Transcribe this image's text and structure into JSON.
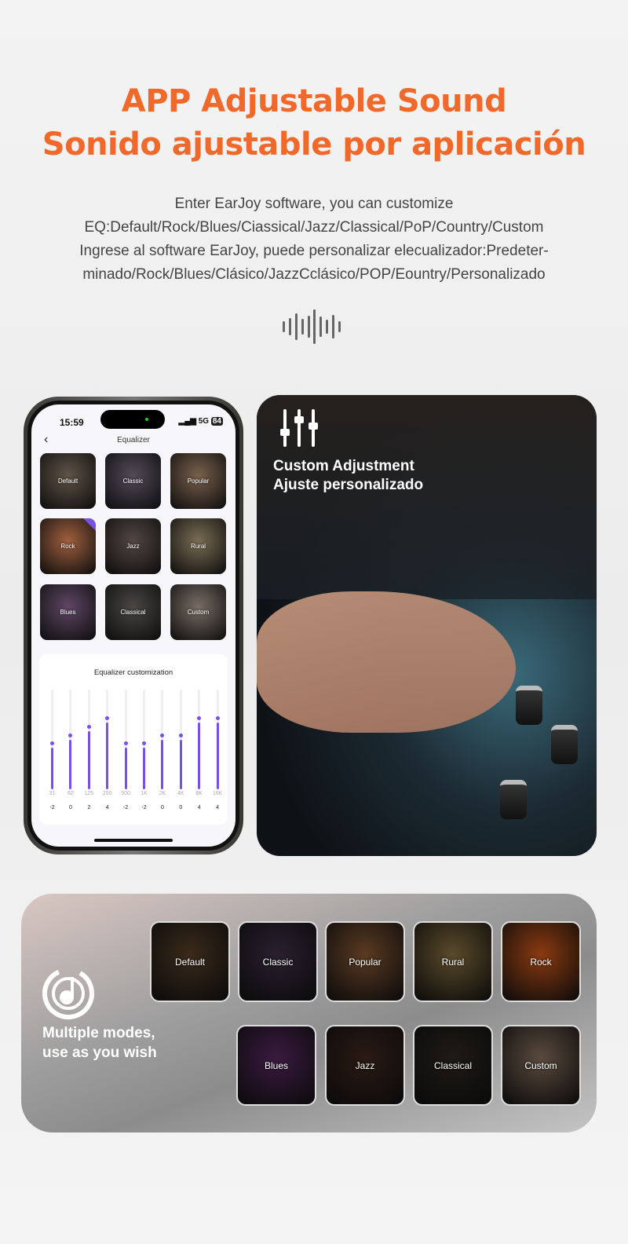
{
  "header": {
    "title_en": "APP Adjustable Sound",
    "title_es": "Sonido ajustable por aplicación",
    "accent": "#f0692a"
  },
  "description": [
    "Enter EarJoy software, you can customize",
    "EQ:Default/Rock/Blues/Ciassical/Jazz/Classical/PoP/Country/Custom",
    "Ingrese al software EarJoy, puede personalizar elecualizador:Predeter-",
    "minado/Rock/Blues/Clásico/JazzCclásico/POP/Eountry/Personalizado"
  ],
  "decor_icon": "sound-wave-icon",
  "phone": {
    "status": {
      "time": "15:59",
      "network": "5G",
      "battery": "84"
    },
    "nav": {
      "title": "Equalizer",
      "back_icon": "chevron-left-icon"
    },
    "presets": [
      {
        "label": "Default",
        "selected": false,
        "color": "#3a2a1a"
      },
      {
        "label": "Classic",
        "selected": false,
        "color": "#2a2030"
      },
      {
        "label": "Popular",
        "selected": false,
        "color": "#5a3a22"
      },
      {
        "label": "Rock",
        "selected": true,
        "color": "#8a3a10"
      },
      {
        "label": "Jazz",
        "selected": false,
        "color": "#2a1a14"
      },
      {
        "label": "Rural",
        "selected": false,
        "color": "#5a4a2a"
      },
      {
        "label": "Blues",
        "selected": false,
        "color": "#3a1a40"
      },
      {
        "label": "Classical",
        "selected": false,
        "color": "#1e1a16"
      },
      {
        "label": "Custom",
        "selected": false,
        "color": "#5a4a3e"
      }
    ],
    "eq": {
      "title": "Equalizer customization",
      "range_db": [
        -12,
        12
      ],
      "bands": [
        {
          "freq": "31",
          "gain": "-2"
        },
        {
          "freq": "62",
          "gain": "0"
        },
        {
          "freq": "125",
          "gain": "2"
        },
        {
          "freq": "250",
          "gain": "4"
        },
        {
          "freq": "500",
          "gain": "-2"
        },
        {
          "freq": "1K",
          "gain": "-2"
        },
        {
          "freq": "2K",
          "gain": "0"
        },
        {
          "freq": "4K",
          "gain": "0"
        },
        {
          "freq": "8K",
          "gain": "4"
        },
        {
          "freq": "16K",
          "gain": "4"
        }
      ],
      "accent": "#7a4fe6"
    }
  },
  "custom_panel": {
    "icon": "sliders-icon",
    "title_en": "Custom Adjustment",
    "title_es": "Ajuste personalizado"
  },
  "modes_panel": {
    "icon": "music-note-circle-icon",
    "text_line1": "Multiple modes,",
    "text_line2": "use as you wish",
    "row1": [
      {
        "label": "Default",
        "color": "#3a2a1a"
      },
      {
        "label": "Classic",
        "color": "#2a2030"
      },
      {
        "label": "Popular",
        "color": "#5a3a22"
      },
      {
        "label": "Rural",
        "color": "#5a4a2a"
      },
      {
        "label": "Rock",
        "color": "#8a3a10"
      }
    ],
    "row2": [
      {
        "label": "Blues",
        "color": "#3a1a40"
      },
      {
        "label": "Jazz",
        "color": "#2a1a14"
      },
      {
        "label": "Classical",
        "color": "#1e1a16"
      },
      {
        "label": "Custom",
        "color": "#5a4a3e"
      }
    ]
  }
}
